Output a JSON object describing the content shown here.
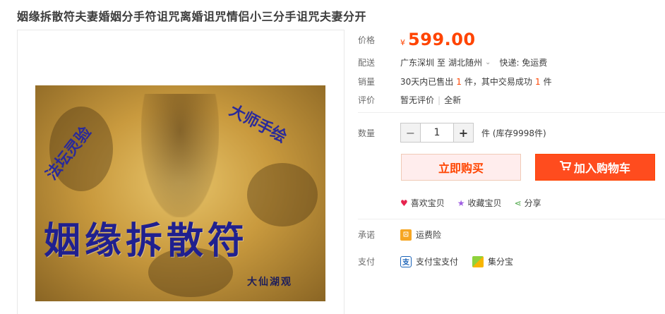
{
  "title": "姻缘拆散符夫妻婚姻分手符诅咒离婚诅咒情侣小三分手诅咒夫妻分开",
  "image": {
    "big_text": "姻缘拆散符",
    "left_text": "法坛灵验",
    "right_text": "大师手绘",
    "signature": "大仙湖观"
  },
  "price": {
    "label": "价格",
    "currency": "¥",
    "value": "599.00"
  },
  "shipping": {
    "label": "配送",
    "from": "广东深圳",
    "to_word": "至",
    "destination": "湖北随州",
    "express": "快递: 免运费"
  },
  "sales": {
    "label": "销量",
    "prefix": "30天内已售出",
    "sold": "1",
    "unit1": "件，其中交易成功",
    "success": "1",
    "unit2": "件"
  },
  "rating": {
    "label": "评价",
    "none": "暂无评价",
    "sep": "|",
    "all": "全新"
  },
  "quantity": {
    "label": "数量",
    "minus": "−",
    "value": "1",
    "plus": "+",
    "stock": "件 (库存9998件)"
  },
  "buttons": {
    "buy_now": "立即购买",
    "add_cart": "加入购物车"
  },
  "social": {
    "like": "喜欢宝贝",
    "favorite": "收藏宝贝",
    "share": "分享"
  },
  "promise": {
    "label": "承诺",
    "item": "运费险"
  },
  "payment": {
    "label": "支付",
    "alipay": "支付宝支付",
    "jifenbao": "集分宝"
  },
  "colors": {
    "accent": "#ff4400",
    "cart_button": "#ff4c1e",
    "buy_button_bg": "#ffeded"
  },
  "icons": {
    "chevron": "chevron-down-icon",
    "cart": "cart-icon",
    "heart": "heart-icon",
    "star": "star-icon",
    "share": "share-icon",
    "freight": "freight-insurance-icon",
    "alipay": "alipay-icon",
    "jifenbao": "jifenbao-icon"
  }
}
